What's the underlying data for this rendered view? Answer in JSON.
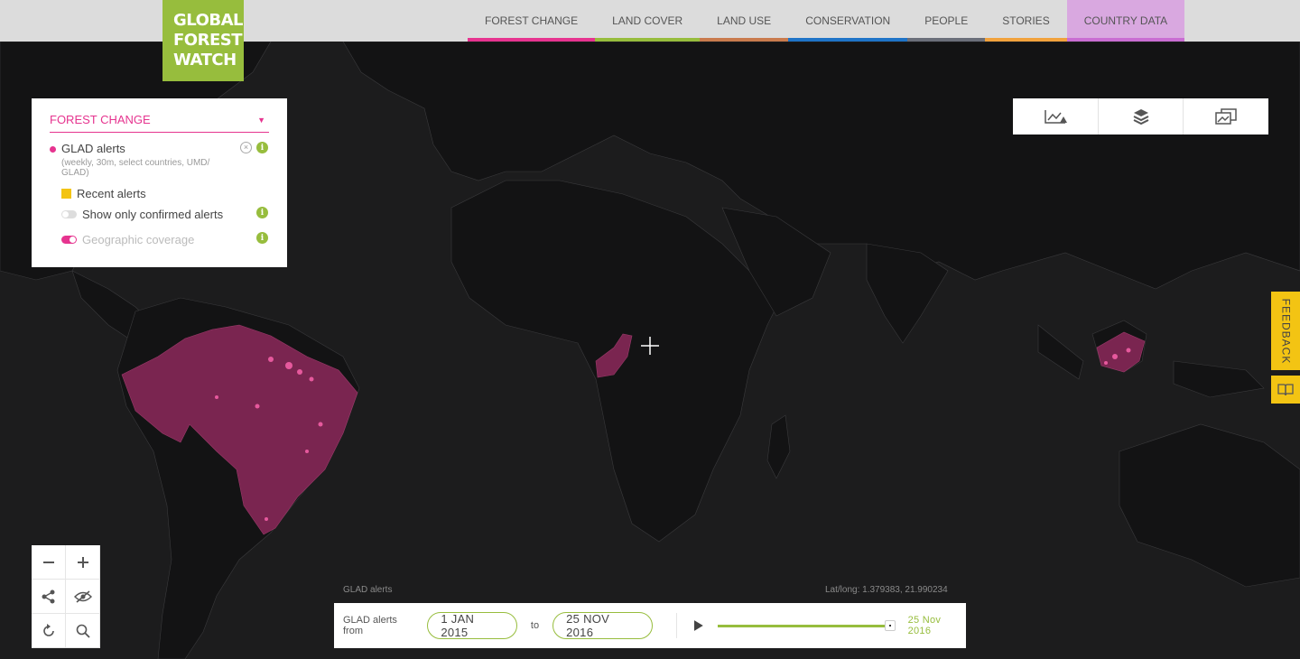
{
  "logo": {
    "line1": "GLOBAL",
    "line2": "FOREST",
    "line3": "WATCH"
  },
  "nav": {
    "items": [
      {
        "label": "FOREST CHANGE",
        "color": "#e6348f"
      },
      {
        "label": "LAND COVER",
        "color": "#97bd3d"
      },
      {
        "label": "LAND USE",
        "color": "#c97b4d"
      },
      {
        "label": "CONSERVATION",
        "color": "#1f74c7"
      },
      {
        "label": "PEOPLE",
        "color": "#6b6f7a"
      },
      {
        "label": "STORIES",
        "color": "#f1a23d"
      },
      {
        "label": "COUNTRY DATA",
        "color": "#c96dd2"
      }
    ],
    "active": "COUNTRY DATA"
  },
  "legend": {
    "category": "FOREST CHANGE",
    "layer_name": "GLAD alerts",
    "layer_color": "#e6348f",
    "layer_sub": "(weekly, 30m, select countries, UMD/ GLAD)",
    "recent_label": "Recent alerts",
    "recent_color": "#f3c413",
    "confirmed_label": "Show only confirmed alerts",
    "confirmed_on": false,
    "coverage_label": "Geographic coverage",
    "coverage_on": true
  },
  "tools": {
    "analysis_icon": "analysis-chart-icon",
    "layers_icon": "layers-icon",
    "basemap_icon": "basemap-icon"
  },
  "feedback": {
    "label": "FEEDBACK",
    "guide_icon": "book-icon"
  },
  "controls": {
    "zoom_out": "minus-icon",
    "zoom_in": "plus-icon",
    "share": "share-icon",
    "hide": "eye-slash-icon",
    "reset": "refresh-icon",
    "search": "search-icon"
  },
  "map_caption": {
    "layer": "GLAD alerts",
    "latlong": "Lat/long: 1.379383, 21.990234"
  },
  "timeline": {
    "label": "GLAD alerts from",
    "from": "1 JAN 2015",
    "to_word": "to",
    "to": "25 NOV 2016",
    "current": "25 Nov 2016",
    "progress": 1.0
  },
  "colors": {
    "accent": "#97bd3d",
    "alert": "#e6348f",
    "coverage": "#7a2550",
    "land": "#131314",
    "ocean": "#1c1c1d"
  }
}
